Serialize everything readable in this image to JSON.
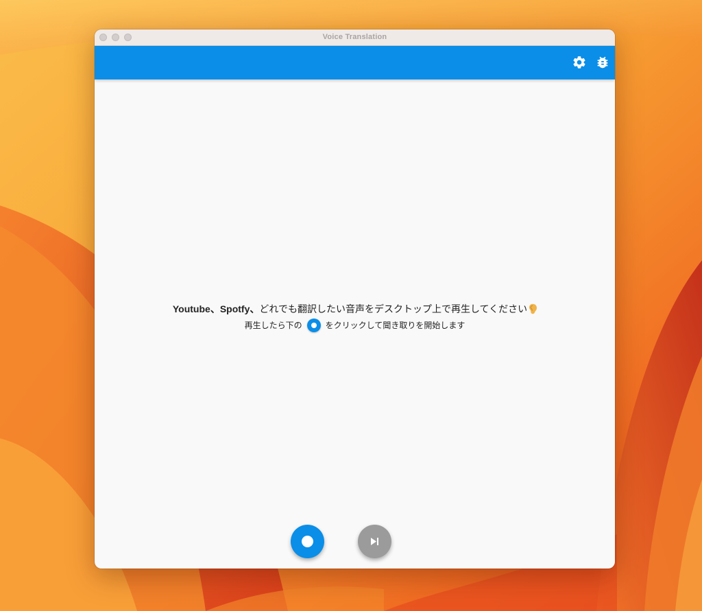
{
  "window": {
    "title": "Voice Translation"
  },
  "appbar": {
    "color": "#0a8ee8",
    "icons": [
      "gear-icon",
      "bug-icon"
    ]
  },
  "message": {
    "line1_bold_prefix": "Youtube、Spotfy、",
    "line1_text": "どれでも翻訳したい音声をデスクトップ上で再生してください",
    "line1_emoji": "ear-icon",
    "line2_before": "再生したら下の",
    "line2_after": "をクリックして聞き取りを開始します"
  },
  "controls": {
    "record_icon": "record-icon",
    "skip_icon": "skip-next-icon",
    "record_color": "#0a8ee8",
    "skip_color": "#9b9b9b"
  }
}
